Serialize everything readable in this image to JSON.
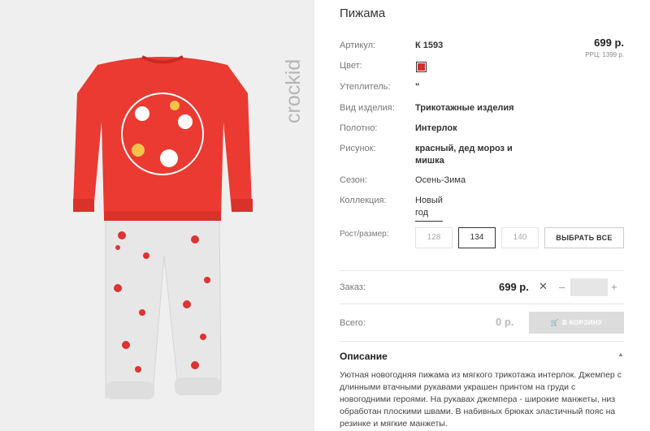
{
  "product": {
    "title": "Пижама",
    "price": "699 р.",
    "rrp": "РРЦ: 1399 р.",
    "color_hex": "#d82b2b",
    "brand_logo_text": "crockid"
  },
  "attributes": {
    "article_label": "Артикул:",
    "article_value": "К 1593",
    "color_label": "Цвет:",
    "insulation_label": "Утеплитель:",
    "insulation_value": "\"",
    "type_label": "Вид изделия:",
    "type_value": "Трикотажные изделия",
    "fabric_label": "Полотно:",
    "fabric_value": "Интерлок",
    "print_label": "Рисунок:",
    "print_value": "красный, дед мороз и мишка",
    "season_label": "Сезон:",
    "season_value": "Осень-Зима",
    "collection_label": "Коллекция:",
    "collection_value": "Новый год"
  },
  "sizes": {
    "label": "Рост/размер:",
    "options": [
      "128",
      "134",
      "140"
    ],
    "selected": "134",
    "select_all_label": "ВЫБРАТЬ ВСЕ"
  },
  "order": {
    "label": "Заказ:",
    "price": "699 р.",
    "times": "✕",
    "minus": "–",
    "plus": "+",
    "quantity": ""
  },
  "total": {
    "label": "Всего:",
    "value": "0 р.",
    "cart_button": "В КОРЗИНУ"
  },
  "description": {
    "heading": "Описание",
    "text": "Уютная новогодняя пижама из мягкого трикотажа интерлок. Джемпер с длинными втачными рукавами украшен принтом на груди с новогодними героями. На рукавах джемпера - широкие манжеты, низ обработан плоскими швами. В набивных брюках эластичный пояс на резинке и мягкие манжеты."
  }
}
